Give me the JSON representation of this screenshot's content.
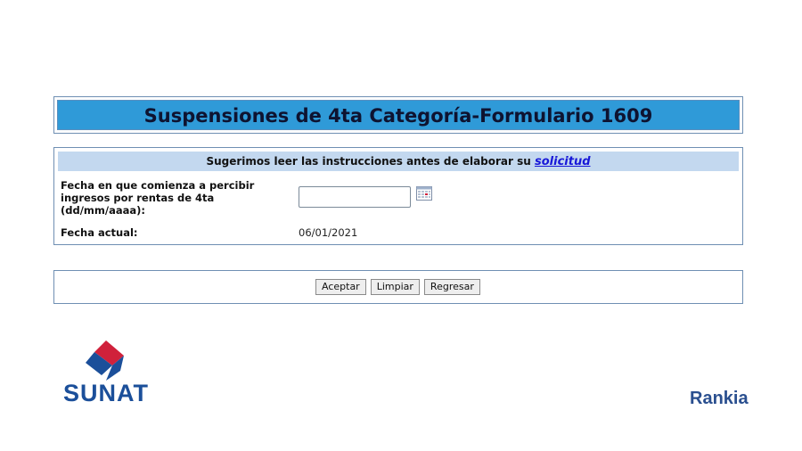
{
  "header": {
    "title": "Suspensiones de 4ta Categoría-Formulario 1609"
  },
  "form": {
    "hint_text": "Sugerimos leer las instrucciones antes de elaborar su ",
    "hint_link": "solicitud",
    "start_date_label": "Fecha en que comienza a percibir ingresos por rentas de 4ta (dd/mm/aaaa):",
    "start_date_value": "",
    "current_date_label": "Fecha actual:",
    "current_date_value": "06/01/2021"
  },
  "buttons": {
    "accept": "Aceptar",
    "clear": "Limpiar",
    "back": "Regresar"
  },
  "logos": {
    "sunat": "SUNAT",
    "rankia": "Rankia"
  },
  "colors": {
    "title_bar": "#2f9ad8",
    "hint_bar": "#c3d8ef",
    "link": "#1818d8",
    "sunat_blue": "#1b4f9a",
    "sunat_red": "#d0213b"
  }
}
